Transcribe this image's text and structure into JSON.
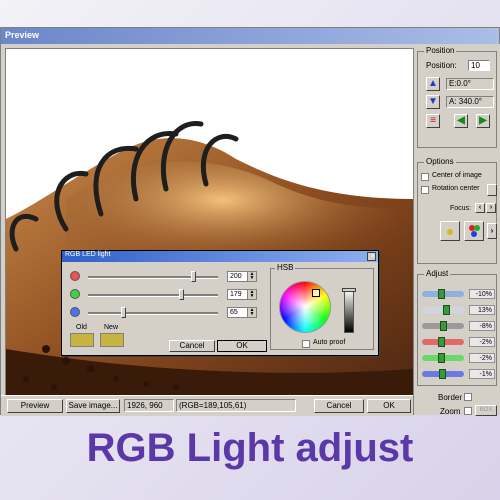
{
  "window": {
    "title": "Preview"
  },
  "bottom_bar": {
    "preview_label": "Preview",
    "save_label": "Save image...",
    "coords": "1926, 960",
    "rgb_readout": "(RGB=189,105,61)",
    "cancel_label": "Cancel",
    "ok_label": "OK"
  },
  "position": {
    "group_label": "Position",
    "position_label": "Position:",
    "position_value": "10",
    "e_value": "E:0.0°",
    "a_value": "A: 340.0°"
  },
  "options": {
    "group_label": "Options",
    "center_label": "Center of image",
    "rotation_label": "Rotation center",
    "focus_label": "Focus:"
  },
  "adjust": {
    "group_label": "Adjust",
    "rows": [
      {
        "value": "-10%",
        "color": "#8fb1e0",
        "level": 0.45
      },
      {
        "value": "13%",
        "color": "#cfd6de",
        "level": 0.6
      },
      {
        "value": "-8%",
        "color": "#9a9a9a",
        "level": 0.5
      },
      {
        "value": "-2%",
        "color": "#e06a6a",
        "level": 0.45
      },
      {
        "value": "-2%",
        "color": "#6ad86a",
        "level": 0.45
      },
      {
        "value": "-1%",
        "color": "#6a7ae0",
        "level": 0.48
      }
    ],
    "border_label": "Border",
    "zoom_label": "Zoom",
    "box_label": "BOX"
  },
  "dialog": {
    "title": "RGB LED light",
    "hsb_label": "HSB",
    "red_value": "200",
    "green_value": "179",
    "blue_value": "65",
    "red_level": 0.82,
    "green_level": 0.73,
    "blue_level": 0.26,
    "old_label": "Old",
    "new_label": "New",
    "auto_preview_label": "Auto proof",
    "cancel_label": "Cancel",
    "ok_label": "OK",
    "swatch_color": "#c8b341"
  },
  "caption": "RGB Light adjust",
  "colors": {
    "accent": "#5a38a8",
    "title_bar": "#6b86c9"
  }
}
